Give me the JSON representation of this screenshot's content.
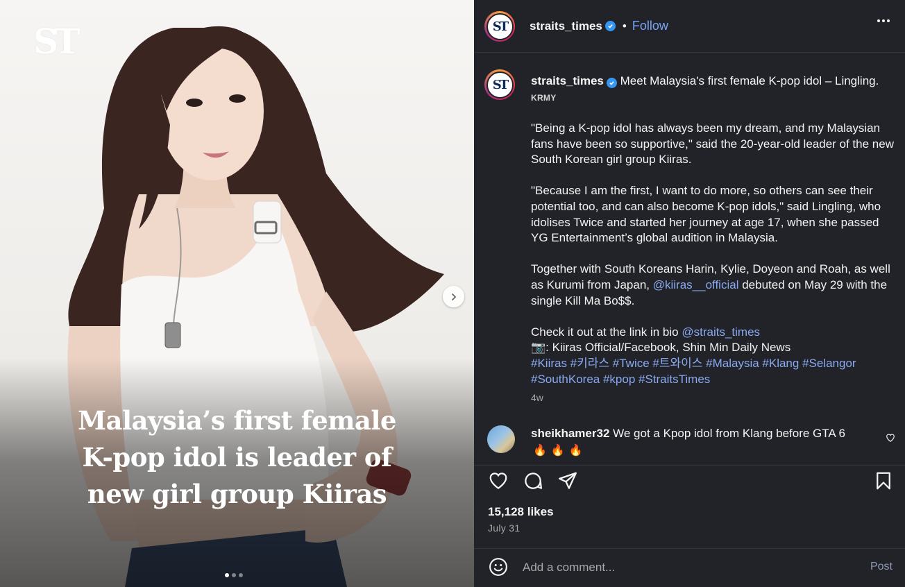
{
  "media": {
    "watermark": "ST",
    "headline_lines": [
      "Malaysia’s first female",
      "K-pop idol is leader of",
      "new girl group Kiiras"
    ],
    "carousel": {
      "count": 3,
      "active_index": 0
    }
  },
  "header": {
    "avatar_text": "ST",
    "username": "straits_times",
    "separator": "•",
    "follow_label": "Follow"
  },
  "caption": {
    "avatar_text": "ST",
    "username": "straits_times",
    "headline": "Meet Malaysia's first female K-pop idol – Lingling.",
    "subtitle": "KRMY",
    "paragraph_1": "\"Being a K-pop idol has always been my dream, and my Malaysian fans have been so supportive,\" said the 20-year-old leader of the new South Korean girl group Kiiras.",
    "paragraph_2": "\"Because I am the first, I want to do more, so others can see their potential too, and can also become K-pop idols,\" said Lingling, who idolises Twice and started her journey at age 17, when she passed YG Entertainment’s global audition in Malaysia.",
    "paragraph_3_pre": "Together with South Koreans Harin, Kylie, Doyeon and Roah, as well as Kurumi from Japan,",
    "paragraph_3_mention": "@kiiras__official",
    "paragraph_3_post": "debuted on May 29 with the single Kill Ma Bo$$.",
    "cta_pre": "Check it out at the link in bio",
    "cta_mention": "@straits_times",
    "photo_credit": "📷: Kiiras Official/Facebook, Shin Min Daily News",
    "hashtags_line_1": "#Kiiras #키라스 #Twice #트와이스 #Malaysia #Klang #Selangor",
    "hashtags_line_2": "#SouthKorea #kpop #StraitsTimes",
    "time_ago": "4w"
  },
  "comment": {
    "username": "sheikhamer32",
    "text": "We got a Kpop idol from Klang before GTA 6",
    "emojis": "🔥🔥🔥"
  },
  "stats": {
    "likes": "15,128 likes",
    "date": "July 31"
  },
  "comment_box": {
    "placeholder": "Add a comment...",
    "post_label": "Post"
  },
  "colors": {
    "panel_bg": "#212328",
    "link": "#8aa9f0",
    "follow": "#7aa5f5",
    "verified": "#3797f0"
  }
}
